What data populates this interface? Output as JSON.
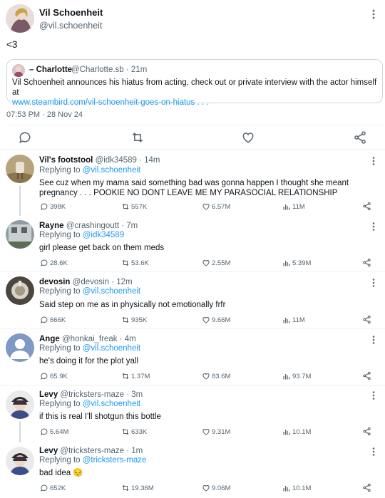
{
  "main_tweet": {
    "name": "Vil Schoenheit",
    "handle": "@vil.schoenheit",
    "text": "<3",
    "quote": {
      "name": "– Charlotte",
      "handle_time": "@Charlotte.sb · 21m",
      "text": "Vil Schoenheit announces his hiatus from acting, check out or private interview with the actor himself at",
      "link": "www.steambird.com/vil-schoenheit-goes-on-hiatus . . ."
    },
    "timestamp": "07:53 PM · 28 Nov 24"
  },
  "replies": [
    {
      "name": "Vil's footstool",
      "handle_time": "@idk34589 · 14m",
      "replying_prefix": "Replying to ",
      "replying_to": "@vil.schoenheit",
      "text": "See cuz when my mama said something bad was gonna happen I thought she meant pregnancy . . . POOKIE NO DONT LEAVE ME MY PARASOCIAL RELATIONSHIP",
      "stats": {
        "replies": "398K",
        "retweets": "557K",
        "likes": "6.57M",
        "views": "11M"
      }
    },
    {
      "name": "Rayne",
      "handle_time": "@crashingoutt · 7m",
      "replying_prefix": "Replying to ",
      "replying_to": "@idk34589",
      "text": "girl please get back on them meds",
      "stats": {
        "replies": "28.6K",
        "retweets": "53.6K",
        "likes": "2.55M",
        "views": "5.39M"
      }
    },
    {
      "name": "devosin",
      "handle_time": "@devosin · 12m",
      "replying_prefix": "Replying to ",
      "replying_to": "@vil.schoenheit",
      "text": "Said step on me as in physically not emotionally frfr",
      "stats": {
        "replies": "666K",
        "retweets": "935K",
        "likes": "9.66M",
        "views": "11M"
      }
    },
    {
      "name": "Ange",
      "handle_time": "@honkai_freak · 4m",
      "replying_prefix": "Replying to ",
      "replying_to": "@vil.schoenheit",
      "text": "he's doing it for the plot yall",
      "stats": {
        "replies": "65.9K",
        "retweets": "1.37M",
        "likes": "83.6M",
        "views": "93.7M"
      }
    },
    {
      "name": "Levy",
      "handle_time": "@tricksters-maze · 3m",
      "replying_prefix": "Replying to ",
      "replying_to": "@vil.schoenheit",
      "text": "if this is real I'll shotgun this bottle",
      "stats": {
        "replies": "5.64M",
        "retweets": "633K",
        "likes": "9.31M",
        "views": "10.1M"
      }
    },
    {
      "name": "Levy",
      "handle_time": "@tricksters-maze · 1m",
      "replying_prefix": "Replying to ",
      "replying_to": "@tricksters-maze",
      "text": "bad idea 😔",
      "stats": {
        "replies": "652K",
        "retweets": "19.36M",
        "likes": "9.06M",
        "views": "10.1M"
      }
    }
  ],
  "colors": {
    "link": "#1d9bf0",
    "muted": "#536471",
    "border": "#cfd9de"
  }
}
